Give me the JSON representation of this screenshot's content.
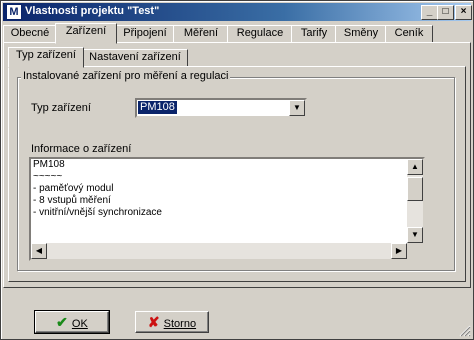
{
  "window": {
    "title": "Vlastnosti projektu \"Test\"",
    "icon": "M",
    "controls": {
      "minimize": "_",
      "maximize": "□",
      "close": "×"
    }
  },
  "main_tabs": [
    {
      "label": "Obecné",
      "active": false
    },
    {
      "label": "Zařízení",
      "active": true
    },
    {
      "label": "Připojení",
      "active": false
    },
    {
      "label": "Měření",
      "active": false
    },
    {
      "label": "Regulace",
      "active": false
    },
    {
      "label": "Tarify",
      "active": false
    },
    {
      "label": "Směny",
      "active": false
    },
    {
      "label": "Ceník",
      "active": false
    }
  ],
  "sub_tabs": [
    {
      "label": "Typ zařízení",
      "active": true
    },
    {
      "label": "Nastavení zařízení",
      "active": false
    }
  ],
  "group": {
    "title": "Instalované zařízení pro měření a regulaci",
    "device_type_label": "Typ zařízení",
    "device_type_value": "PM108",
    "info_label": "Informace o zařízení",
    "info_lines": [
      "PM108",
      "~~~~~",
      "- paměťový modul",
      "- 8 vstupů měření",
      "- vnitřní/vnější synchronizace"
    ]
  },
  "buttons": {
    "ok": "OK",
    "cancel": "Storno"
  },
  "colors": {
    "title_start": "#0a246a",
    "ok_check": "#1a8a1a",
    "cancel_x": "#cc1111"
  },
  "icons": [
    "check-icon",
    "cross-icon",
    "chevron-down-icon",
    "arrow-up-icon",
    "arrow-down-icon",
    "arrow-left-icon",
    "arrow-right-icon",
    "resize-grip-icon"
  ]
}
